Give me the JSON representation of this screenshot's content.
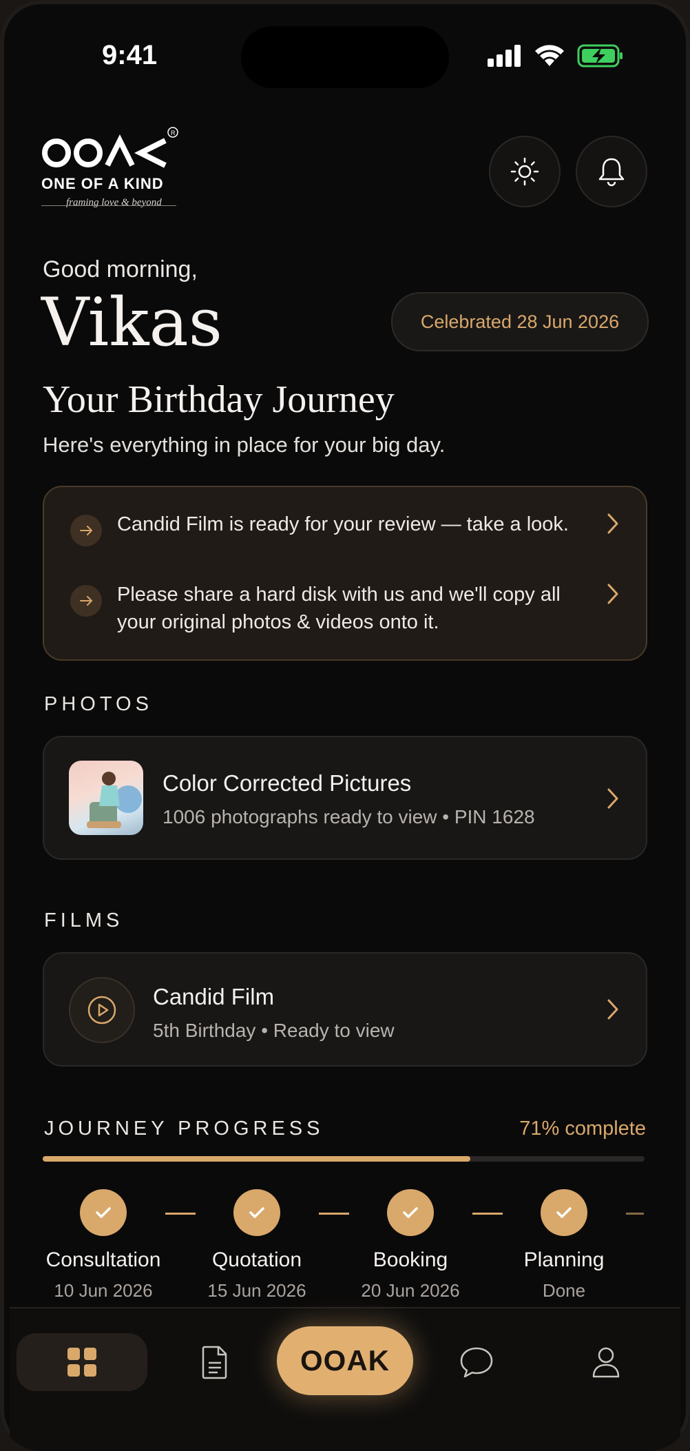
{
  "status_bar": {
    "time": "9:41"
  },
  "brand": {
    "logo_mark": "OOAK",
    "logo_line": "ONE OF A KIND",
    "tagline": "framing love & beyond"
  },
  "header": {
    "theme_icon": "sun-icon",
    "notifications_icon": "bell-icon"
  },
  "greeting": {
    "salutation": "Good morning,",
    "name": "Vikas",
    "celebrated": "Celebrated 28 Jun 2026"
  },
  "journey": {
    "title": "Your Birthday Journey",
    "subtitle": "Here's everything in place for your big day."
  },
  "notices": [
    {
      "text": "Candid Film is ready for your review — take a look."
    },
    {
      "text": "Please share a hard disk with us and we'll copy all your original photos & videos onto it."
    }
  ],
  "photos": {
    "section_label": "PHOTOS",
    "card": {
      "title": "Color Corrected Pictures",
      "subtitle": "1006 photographs ready to view • PIN 1628"
    }
  },
  "films": {
    "section_label": "FILMS",
    "card": {
      "title": "Candid Film",
      "subtitle": "5th Birthday • Ready to view"
    }
  },
  "progress": {
    "label": "JOURNEY PROGRESS",
    "percent_text": "71% complete",
    "percent": 71,
    "steps": [
      {
        "name": "Consultation",
        "date": "10 Jun 2026",
        "done": true
      },
      {
        "name": "Quotation",
        "date": "15 Jun 2026",
        "done": true
      },
      {
        "name": "Booking",
        "date": "20 Jun 2026",
        "done": true
      },
      {
        "name": "Planning",
        "date": "Done",
        "done": true
      }
    ]
  },
  "tabbar": {
    "items": [
      {
        "name": "home",
        "icon": "grid-icon"
      },
      {
        "name": "documents",
        "icon": "document-icon"
      },
      {
        "name": "center",
        "label": "OOAK"
      },
      {
        "name": "chat",
        "icon": "chat-icon"
      },
      {
        "name": "profile",
        "icon": "user-icon"
      }
    ]
  },
  "colors": {
    "accent": "#d9a86b",
    "background": "#0b0a0a",
    "card": "#181716",
    "notice_bg": "#201b16"
  }
}
